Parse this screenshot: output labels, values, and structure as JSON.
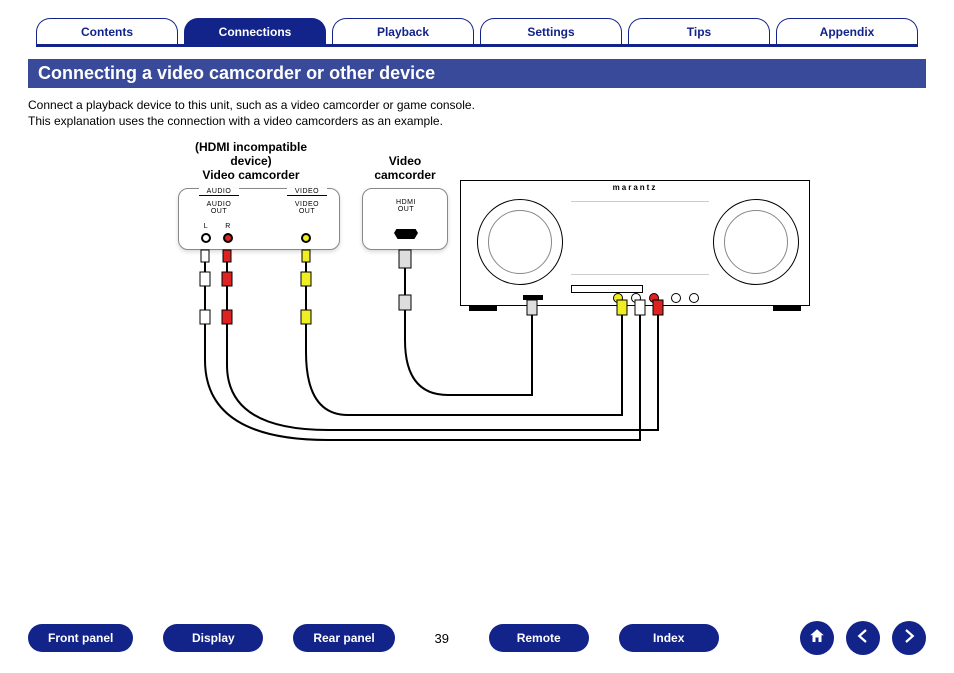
{
  "tabs": [
    {
      "label": "Contents",
      "active": false
    },
    {
      "label": "Connections",
      "active": true
    },
    {
      "label": "Playback",
      "active": false
    },
    {
      "label": "Settings",
      "active": false
    },
    {
      "label": "Tips",
      "active": false
    },
    {
      "label": "Appendix",
      "active": false
    }
  ],
  "section_title": "Connecting a video camcorder or other device",
  "intro": {
    "line1": "Connect a playback device to this unit, such as a video camcorder or game console.",
    "line2": "This explanation uses the connection with a video camcorders as an example."
  },
  "diagram": {
    "device1_title_line1": "(HDMI incompatible",
    "device1_title_line2": "device)",
    "device1_title_line3": "Video camcorder",
    "device2_title_line1": "Video",
    "device2_title_line2": "camcorder",
    "labels": {
      "audio_header": "AUDIO",
      "video_header": "VIDEO",
      "audio_out": "AUDIO\nOUT",
      "video_out": "VIDEO\nOUT",
      "l": "L",
      "r": "R",
      "hdmi_out": "HDMI\nOUT"
    },
    "receiver_brand": "marantz"
  },
  "bottom": {
    "pills": [
      "Front panel",
      "Display",
      "Rear panel"
    ],
    "page_number": "39",
    "pills_right": [
      "Remote",
      "Index"
    ]
  }
}
